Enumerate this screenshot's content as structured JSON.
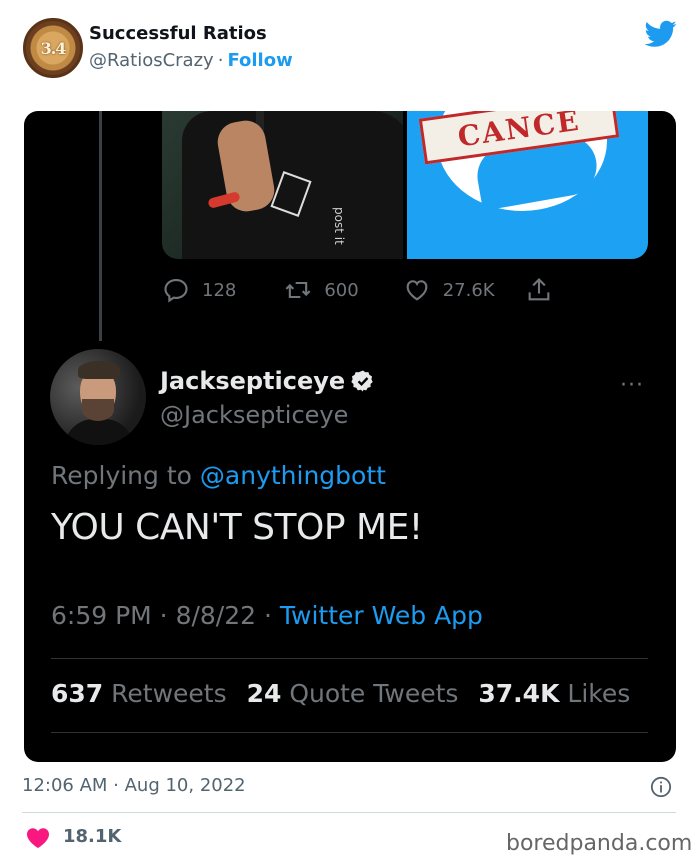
{
  "outer_tweet": {
    "avatar_text": "3.4",
    "display_name": "Successful Ratios",
    "handle": "@RatiosCrazy",
    "separator": "·",
    "follow_label": "Follow",
    "timestamp": "12:06 AM · Aug 10, 2022",
    "like_count": "18.1K"
  },
  "embedded": {
    "media": {
      "left_shirt_print": "post it",
      "right_stamp_text": "CANCE"
    },
    "prev_actions": {
      "replies": "128",
      "retweets": "600",
      "likes": "27.6K"
    },
    "author": {
      "name": "Jacksepticeye",
      "handle": "@Jacksepticeye"
    },
    "more_label": "···",
    "replying_prefix": "Replying to",
    "replying_to": "@anythingbott",
    "text": "YOU CAN'T STOP ME!",
    "meta_time": "6:59 PM · 8/8/22 ·",
    "meta_app": "Twitter Web App",
    "stats": {
      "retweets_count": "637",
      "retweets_label": "Retweets",
      "quotes_count": "24",
      "quotes_label": "Quote Tweets",
      "likes_count": "37.4K",
      "likes_label": "Likes"
    }
  },
  "watermark": "boredpanda.com",
  "colors": {
    "twitter_blue": "#1d9bf0",
    "heart_red": "#f91880",
    "dark_bg": "#000000"
  }
}
